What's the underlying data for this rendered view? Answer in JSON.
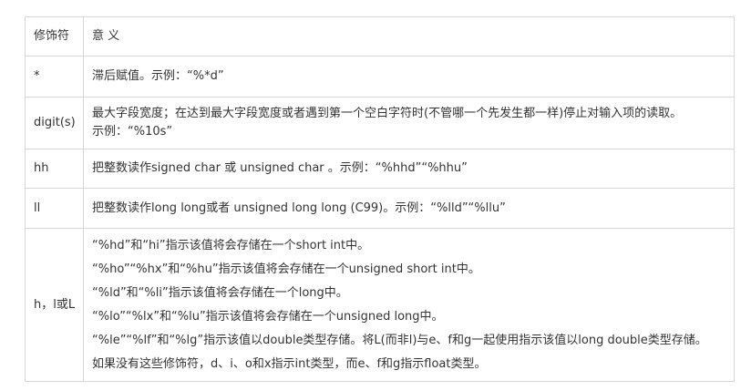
{
  "table": {
    "headers": [
      "修饰符",
      "意 义"
    ],
    "rows": [
      {
        "modifier": "*",
        "lines": [
          "滞后赋值。示例：“%*d”"
        ]
      },
      {
        "modifier": "digit(s)",
        "lines": [
          "最大字段宽度；在达到最大字段宽度或者遇到第一个空白字符时(不管哪一个先发生都一样)停止对输入项的读取。",
          "示例：“%10s”"
        ]
      },
      {
        "modifier": "hh",
        "lines": [
          "把整数读作signed char 或 unsigned char 。示例：“%hhd”“%hhu”"
        ]
      },
      {
        "modifier": "ll",
        "lines": [
          "把整数读作long long或者 unsigned long long (C99)。示例：“%lld”“%llu”"
        ]
      },
      {
        "modifier": "h，l或L",
        "lines": [
          "“%hd”和“hi”指示该值将会存储在一个short int中。",
          "“%ho”“%hx”和“%hu”指示该值将会存储在一个unsigned short int中。",
          "“%ld”和“%li”指示该值将会存储在一个long中。",
          "“%lo”“%lx”和“%lu”指示该值将会存储在一个unsigned long中。",
          "“%le”“%lf”和“%lg”指示该值以double类型存储。将L(而非l)与e、f和g一起使用指示该值以long double类型存储。",
          "如果没有这些修饰符，d、i、o和x指示int类型，而e、f和g指示float类型。"
        ]
      }
    ]
  }
}
